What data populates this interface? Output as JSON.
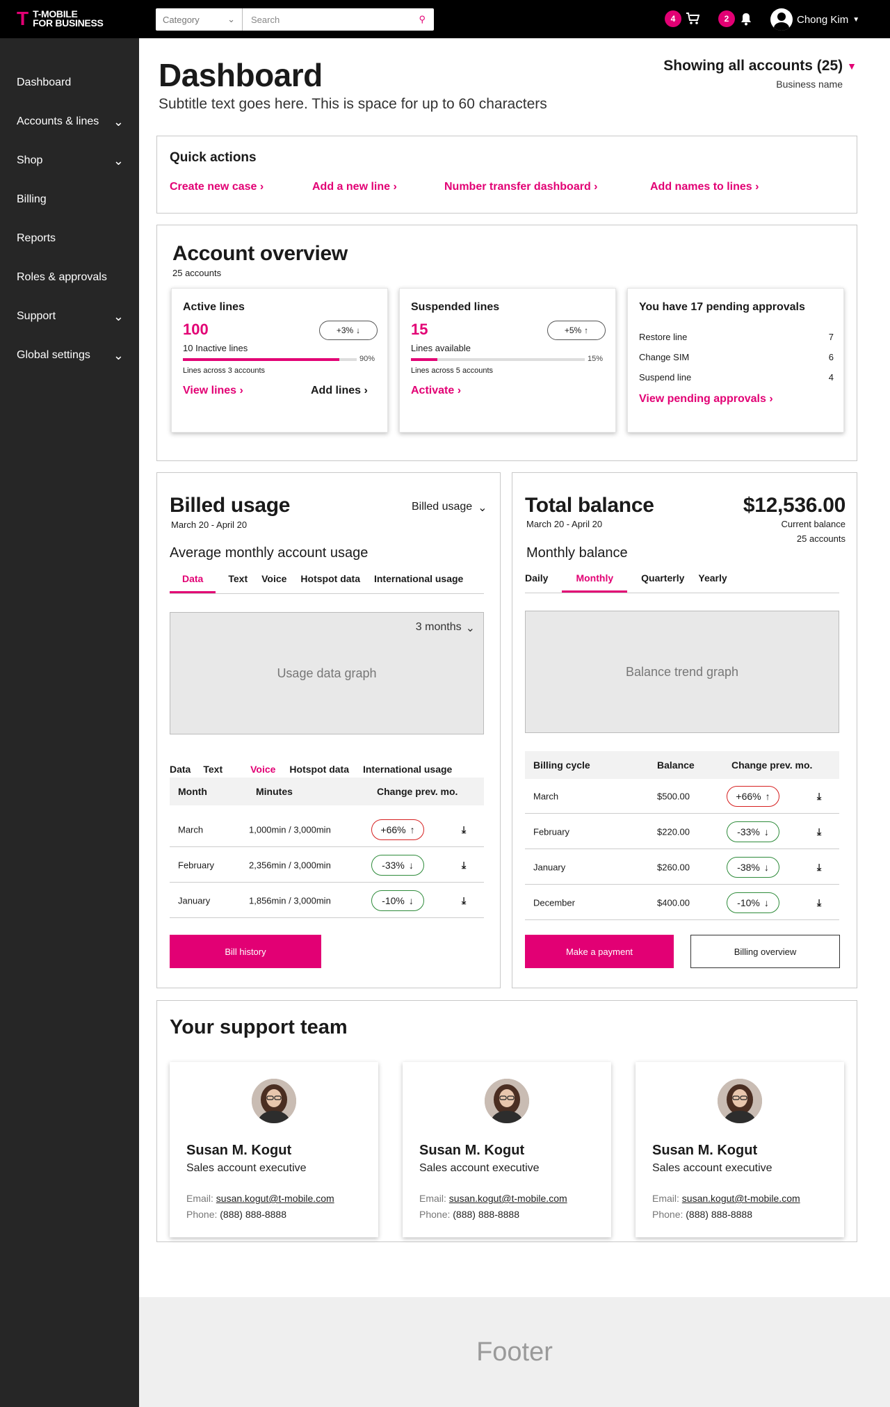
{
  "header": {
    "logo_text_1": "T-MOBILE",
    "logo_text_2": "FOR BUSINESS",
    "category_placeholder": "Category",
    "search_placeholder": "Search",
    "cart_count": "4",
    "notifications_count": "2",
    "user_name": "Chong Kim"
  },
  "sidebar": {
    "items": [
      {
        "label": "Dashboard",
        "chevron": false
      },
      {
        "label": "Accounts & lines",
        "chevron": true
      },
      {
        "label": "Shop",
        "chevron": true
      },
      {
        "label": "Billing",
        "chevron": false
      },
      {
        "label": "Reports",
        "chevron": false
      },
      {
        "label": "Roles & approvals",
        "chevron": false
      },
      {
        "label": "Support",
        "chevron": true
      },
      {
        "label": "Global settings",
        "chevron": true
      }
    ]
  },
  "page": {
    "title": "Dashboard",
    "subtitle": "Subtitle text goes here. This is space for up to 60 characters",
    "account_selector": "Showing all accounts (25)",
    "business_name": "Business name"
  },
  "quick_actions": {
    "title": "Quick actions",
    "links": [
      "Create new case",
      "Add a new line",
      "Number transfer dashboard",
      "Add names to lines"
    ]
  },
  "account_overview": {
    "title": "Account overview",
    "subtitle": "25 accounts",
    "active": {
      "title": "Active lines",
      "count": "100",
      "change": "+3%",
      "secondary": "10 Inactive lines",
      "progress_percent": 90,
      "progress_label": "90%",
      "note": "Lines across 3 accounts",
      "link_1": "View lines",
      "link_2": "Add lines"
    },
    "suspended": {
      "title": "Suspended lines",
      "count": "15",
      "change": "+5%",
      "secondary": "Lines available",
      "progress_percent": 15,
      "progress_label": "15%",
      "note": "Lines across 5 accounts",
      "link_1": "Activate"
    },
    "approvals": {
      "title": "You have 17 pending approvals",
      "items": [
        {
          "label": "Restore line",
          "count": "7"
        },
        {
          "label": "Change SIM",
          "count": "6"
        },
        {
          "label": "Suspend line",
          "count": "4"
        }
      ],
      "link": "View pending approvals"
    }
  },
  "billed_usage": {
    "title": "Billed usage",
    "date_range": "March 20 - April 20",
    "dropdown": "Billed usage",
    "section_title": "Average monthly account usage",
    "tabs": [
      "Data",
      "Text",
      "Voice",
      "Hotspot data",
      "International usage"
    ],
    "graph_range": "3 months",
    "graph_label": "Usage data graph",
    "table_tabs": [
      "Data",
      "Text",
      "Voice",
      "Hotspot data",
      "International usage"
    ],
    "columns": [
      "Month",
      "Minutes",
      "Change prev. mo."
    ],
    "rows": [
      {
        "month": "March",
        "value": "1,000min / 3,000min",
        "change": "+66%",
        "dir": "up"
      },
      {
        "month": "February",
        "value": "2,356min / 3,000min",
        "change": "-33%",
        "dir": "down"
      },
      {
        "month": "January",
        "value": "1,856min / 3,000min",
        "change": "-10%",
        "dir": "down"
      }
    ],
    "button": "Bill history"
  },
  "total_balance": {
    "title": "Total balance",
    "date_range": "March 20 - April 20",
    "amount": "$12,536.00",
    "amount_label": "Current balance",
    "accounts": "25 accounts",
    "section_title": "Monthly balance",
    "tabs": [
      "Daily",
      "Monthly",
      "Quarterly",
      "Yearly"
    ],
    "graph_label": "Balance trend graph",
    "columns": [
      "Billing cycle",
      "Balance",
      "Change prev. mo."
    ],
    "rows": [
      {
        "cycle": "March",
        "balance": "$500.00",
        "change": "+66%",
        "dir": "up"
      },
      {
        "cycle": "February",
        "balance": "$220.00",
        "change": "-33%",
        "dir": "down"
      },
      {
        "cycle": "January",
        "balance": "$260.00",
        "change": "-38%",
        "dir": "down"
      },
      {
        "cycle": "December",
        "balance": "$400.00",
        "change": "-10%",
        "dir": "down"
      }
    ],
    "button_primary": "Make a payment",
    "button_secondary": "Billing overview"
  },
  "support_team": {
    "title": "Your support team",
    "members": [
      {
        "name": "Susan M. Kogut",
        "role": "Sales account executive",
        "email_label": "Email:",
        "email": "susan.kogut@t-mobile.com",
        "phone_label": "Phone:",
        "phone": "(888) 888-8888"
      },
      {
        "name": "Susan M. Kogut",
        "role": "Sales account executive",
        "email_label": "Email:",
        "email": "susan.kogut@t-mobile.com",
        "phone_label": "Phone:",
        "phone": "(888) 888-8888"
      },
      {
        "name": "Susan M. Kogut",
        "role": "Sales account executive",
        "email_label": "Email:",
        "email": "susan.kogut@t-mobile.com",
        "phone_label": "Phone:",
        "phone": "(888) 888-8888"
      }
    ]
  },
  "footer": {
    "label": "Footer"
  },
  "colors": {
    "brand": "#e20074",
    "sidebar": "#262626",
    "up": "#d62020",
    "down": "#2e8b3a"
  }
}
